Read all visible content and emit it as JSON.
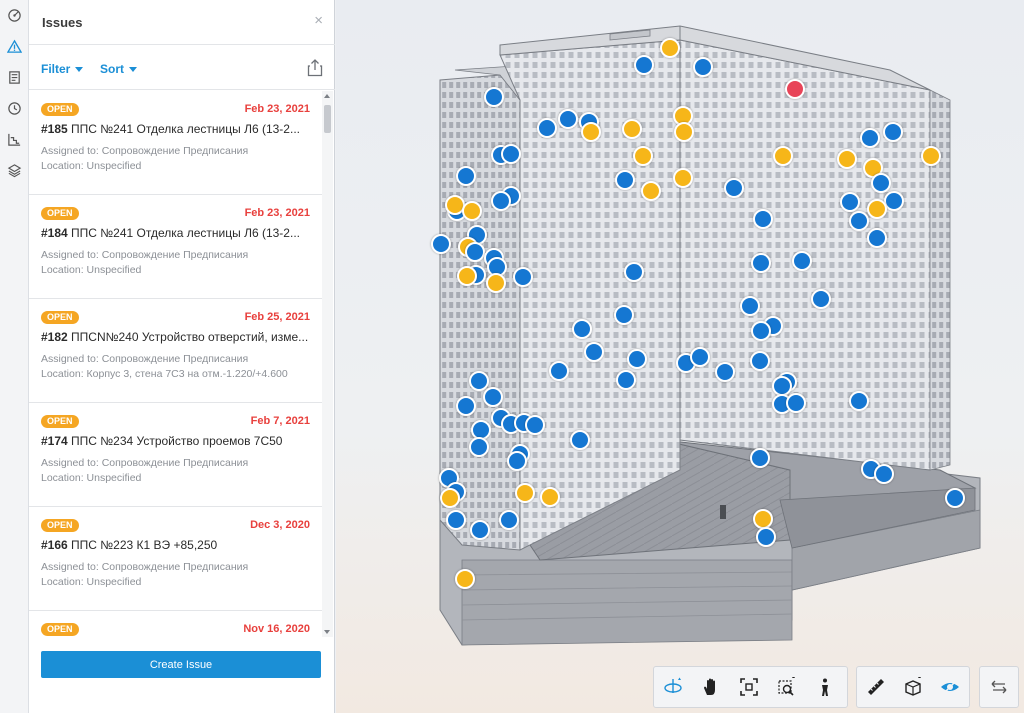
{
  "panel": {
    "title": "Issues",
    "close_icon": "×",
    "filter_label": "Filter",
    "sort_label": "Sort",
    "create_label": "Create Issue"
  },
  "issues": [
    {
      "status": "OPEN",
      "date": "Feb 23, 2021",
      "number": "#185",
      "title": " ППС №241 Отделка лестницы Л6 (13-2...",
      "assigned": "Assigned to: Сопровождение Предписания",
      "location": "Location: Unspecified"
    },
    {
      "status": "OPEN",
      "date": "Feb 23, 2021",
      "number": "#184",
      "title": " ППС №241 Отделка лестницы Л6 (13-2...",
      "assigned": "Assigned to: Сопровождение Предписания",
      "location": "Location: Unspecified"
    },
    {
      "status": "OPEN",
      "date": "Feb 25, 2021",
      "number": "#182",
      "title": " ППСN№240 Устройство отверстий, изме...",
      "assigned": "Assigned to: Сопровождение Предписания",
      "location": "Location: Корпус 3, стена 7С3 на отм.-1.220/+4.600"
    },
    {
      "status": "OPEN",
      "date": "Feb 7, 2021",
      "number": "#174",
      "title": " ППС №234 Устройство проемов 7С50",
      "assigned": "Assigned to: Сопровождение Предписания",
      "location": "Location: Unspecified"
    },
    {
      "status": "OPEN",
      "date": "Dec 3, 2020",
      "number": "#166",
      "title": " ППС №223 К1 ВЭ +85,250",
      "assigned": "Assigned to: Сопровождение Предписания",
      "location": "Location: Unspecified"
    },
    {
      "status": "OPEN",
      "date": "Nov 16, 2020",
      "number": "",
      "title": "",
      "assigned": "",
      "location": ""
    }
  ],
  "colors": {
    "accent": "#1b8fd6",
    "status_open": "#f5a623",
    "date": "#e8403d",
    "pin_blue": "#1577d2",
    "pin_yellow": "#f6b619",
    "pin_red": "#e84458"
  },
  "rail_icons": [
    "model-browser-icon",
    "issues-icon",
    "sheets-icon",
    "history-icon",
    "measure-chart-icon",
    "layers-icon"
  ],
  "nav_icons": [
    "orbit-icon",
    "pan-icon",
    "fit-to-view-icon",
    "zoom-window-icon",
    "first-person-icon",
    "measure-icon",
    "section-box-icon",
    "visibility-icon",
    "swap-icon"
  ]
}
